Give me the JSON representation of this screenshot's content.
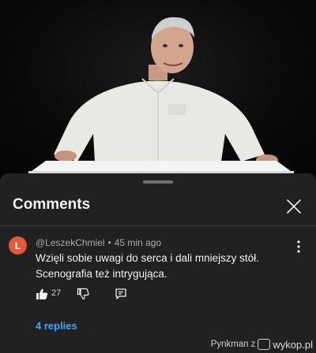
{
  "comments_panel": {
    "title": "Comments",
    "close_icon": "close-icon"
  },
  "comment": {
    "avatar_letter": "L",
    "avatar_color": "#e2593b",
    "author": "@LeszekChmiel",
    "separator": "•",
    "time": "45 min ago",
    "text": "Wzięli sobie uwagi do serca i dali mniejszy stół. Scenografia też intrygująca.",
    "like_count": "27",
    "replies_label": "4 replies"
  },
  "watermark": {
    "author": "Pynkman",
    "connector": "z",
    "brand": "wykop.pl"
  },
  "colors": {
    "link_blue": "#3ea6ff",
    "sheet_background": "#212121"
  }
}
